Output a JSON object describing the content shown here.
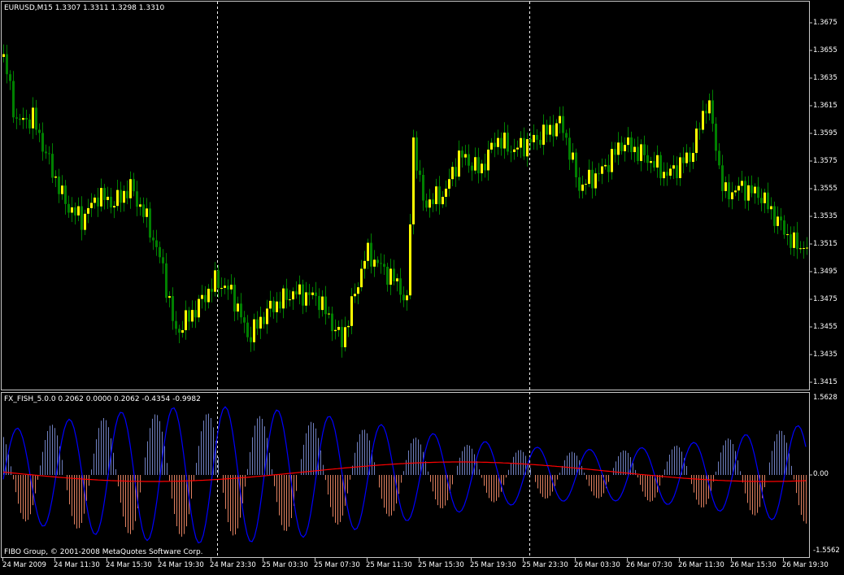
{
  "main_chart": {
    "header": "EURUSD,M15  1.3307 1.3311 1.3298 1.3310",
    "price_axis_labels": [
      "1.3675",
      "1.3655",
      "1.3635",
      "1.3615",
      "1.3595",
      "1.3575",
      "1.3555",
      "1.3535",
      "1.3515",
      "1.3495",
      "1.3475",
      "1.3455",
      "1.3435",
      "1.3415"
    ],
    "bull_color": "#ffff00",
    "bear_color": "#008000"
  },
  "indicator": {
    "header": "FX_FISH_5.0.0 0.2062 0.0000 0.2062 -0.4354 -0.9982",
    "axis_labels": [
      "1.5628",
      "0.00",
      "-1.5562"
    ],
    "footer": "FIBO Group, © 2001-2008 MetaQuotes Software Corp.",
    "positive_color": "#6f7fbf",
    "negative_color": "#e08060",
    "signal_color": "#0000ff",
    "average_color": "#ff0000"
  },
  "time_axis_labels": [
    "24 Mar 2009",
    "24 Mar 11:30",
    "24 Mar 15:30",
    "24 Mar 19:30",
    "24 Mar 23:30",
    "25 Mar 03:30",
    "25 Mar 07:30",
    "25 Mar 11:30",
    "25 Mar 15:30",
    "25 Mar 19:30",
    "25 Mar 23:30",
    "26 Mar 03:30",
    "26 Mar 07:30",
    "26 Mar 11:30",
    "26 Mar 15:30",
    "26 Mar 19:30"
  ]
}
